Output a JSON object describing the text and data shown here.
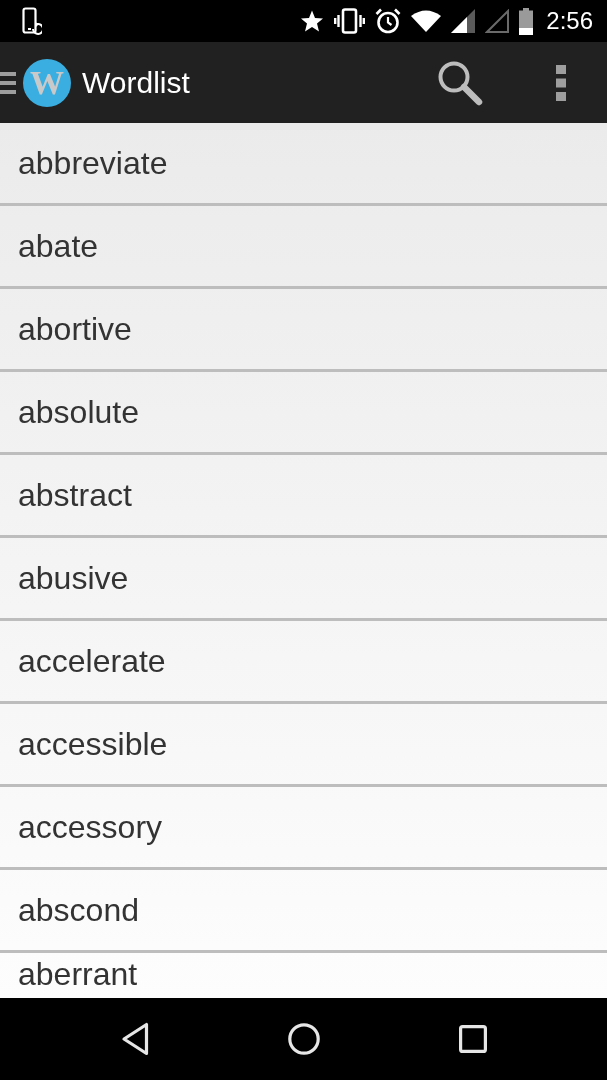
{
  "status_bar": {
    "time": "2:56"
  },
  "app_bar": {
    "logo_letter": "W",
    "title": "Wordlist"
  },
  "words": [
    "abbreviate",
    "abate",
    "abortive",
    "absolute",
    "abstract",
    "abusive",
    "accelerate",
    "accessible",
    "accessory",
    "abscond",
    "aberrant"
  ]
}
